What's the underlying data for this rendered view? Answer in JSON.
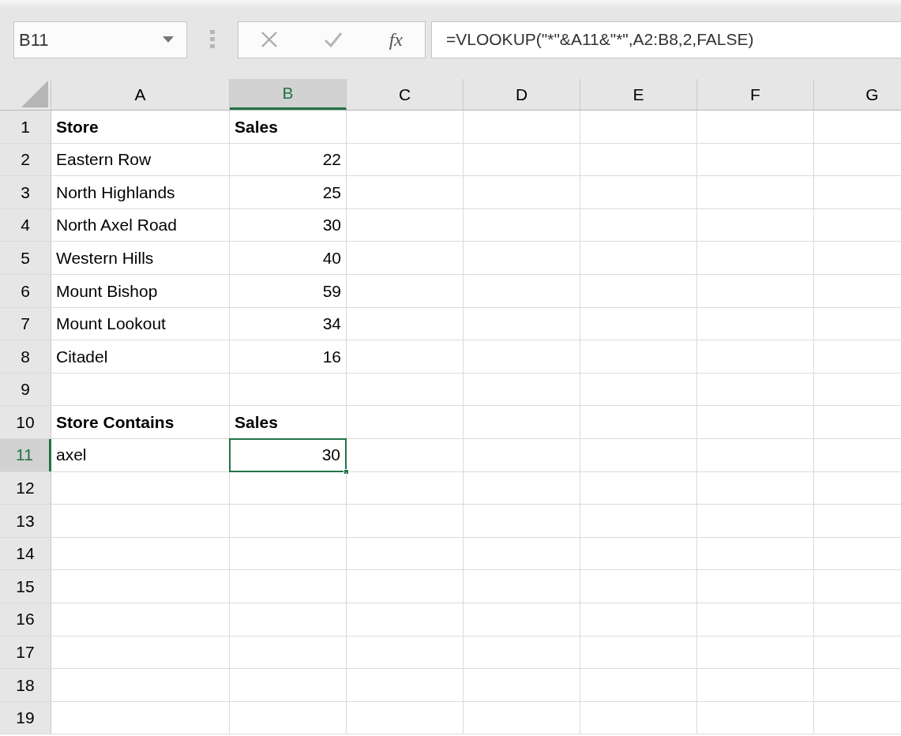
{
  "formula_bar": {
    "name_box": "B11",
    "function_label": "fx",
    "formula": "=VLOOKUP(\"*\"&A11&\"*\",A2:B8,2,FALSE)"
  },
  "columns": [
    {
      "label": "A",
      "selected": false
    },
    {
      "label": "B",
      "selected": true
    },
    {
      "label": "C",
      "selected": false
    },
    {
      "label": "D",
      "selected": false
    },
    {
      "label": "E",
      "selected": false
    },
    {
      "label": "F",
      "selected": false
    },
    {
      "label": "G",
      "selected": false
    }
  ],
  "rows": [
    {
      "label": "1",
      "selected": false,
      "cells": [
        {
          "text": "Store",
          "kind": "text",
          "bold": true,
          "selected": false
        },
        {
          "text": "Sales",
          "kind": "text",
          "bold": true,
          "selected": false
        }
      ]
    },
    {
      "label": "2",
      "selected": false,
      "cells": [
        {
          "text": "Eastern Row",
          "kind": "text",
          "bold": false,
          "selected": false
        },
        {
          "text": "22",
          "kind": "number",
          "bold": false,
          "selected": false
        }
      ]
    },
    {
      "label": "3",
      "selected": false,
      "cells": [
        {
          "text": "North Highlands",
          "kind": "text",
          "bold": false,
          "selected": false
        },
        {
          "text": "25",
          "kind": "number",
          "bold": false,
          "selected": false
        }
      ]
    },
    {
      "label": "4",
      "selected": false,
      "cells": [
        {
          "text": "North Axel Road",
          "kind": "text",
          "bold": false,
          "selected": false
        },
        {
          "text": "30",
          "kind": "number",
          "bold": false,
          "selected": false
        }
      ]
    },
    {
      "label": "5",
      "selected": false,
      "cells": [
        {
          "text": "Western Hills",
          "kind": "text",
          "bold": false,
          "selected": false
        },
        {
          "text": "40",
          "kind": "number",
          "bold": false,
          "selected": false
        }
      ]
    },
    {
      "label": "6",
      "selected": false,
      "cells": [
        {
          "text": "Mount Bishop",
          "kind": "text",
          "bold": false,
          "selected": false
        },
        {
          "text": "59",
          "kind": "number",
          "bold": false,
          "selected": false
        }
      ]
    },
    {
      "label": "7",
      "selected": false,
      "cells": [
        {
          "text": "Mount Lookout",
          "kind": "text",
          "bold": false,
          "selected": false
        },
        {
          "text": "34",
          "kind": "number",
          "bold": false,
          "selected": false
        }
      ]
    },
    {
      "label": "8",
      "selected": false,
      "cells": [
        {
          "text": "Citadel",
          "kind": "text",
          "bold": false,
          "selected": false
        },
        {
          "text": "16",
          "kind": "number",
          "bold": false,
          "selected": false
        }
      ]
    },
    {
      "label": "9",
      "selected": false,
      "cells": []
    },
    {
      "label": "10",
      "selected": false,
      "cells": [
        {
          "text": "Store Contains",
          "kind": "text",
          "bold": true,
          "selected": false
        },
        {
          "text": "Sales",
          "kind": "text",
          "bold": true,
          "selected": false
        }
      ]
    },
    {
      "label": "11",
      "selected": true,
      "cells": [
        {
          "text": "axel",
          "kind": "text",
          "bold": false,
          "selected": false
        },
        {
          "text": "30",
          "kind": "number",
          "bold": false,
          "selected": true
        }
      ]
    },
    {
      "label": "12",
      "selected": false,
      "cells": []
    },
    {
      "label": "13",
      "selected": false,
      "cells": []
    },
    {
      "label": "14",
      "selected": false,
      "cells": []
    },
    {
      "label": "15",
      "selected": false,
      "cells": []
    },
    {
      "label": "16",
      "selected": false,
      "cells": []
    },
    {
      "label": "17",
      "selected": false,
      "cells": []
    },
    {
      "label": "18",
      "selected": false,
      "cells": []
    },
    {
      "label": "19",
      "selected": false,
      "cells": []
    }
  ]
}
